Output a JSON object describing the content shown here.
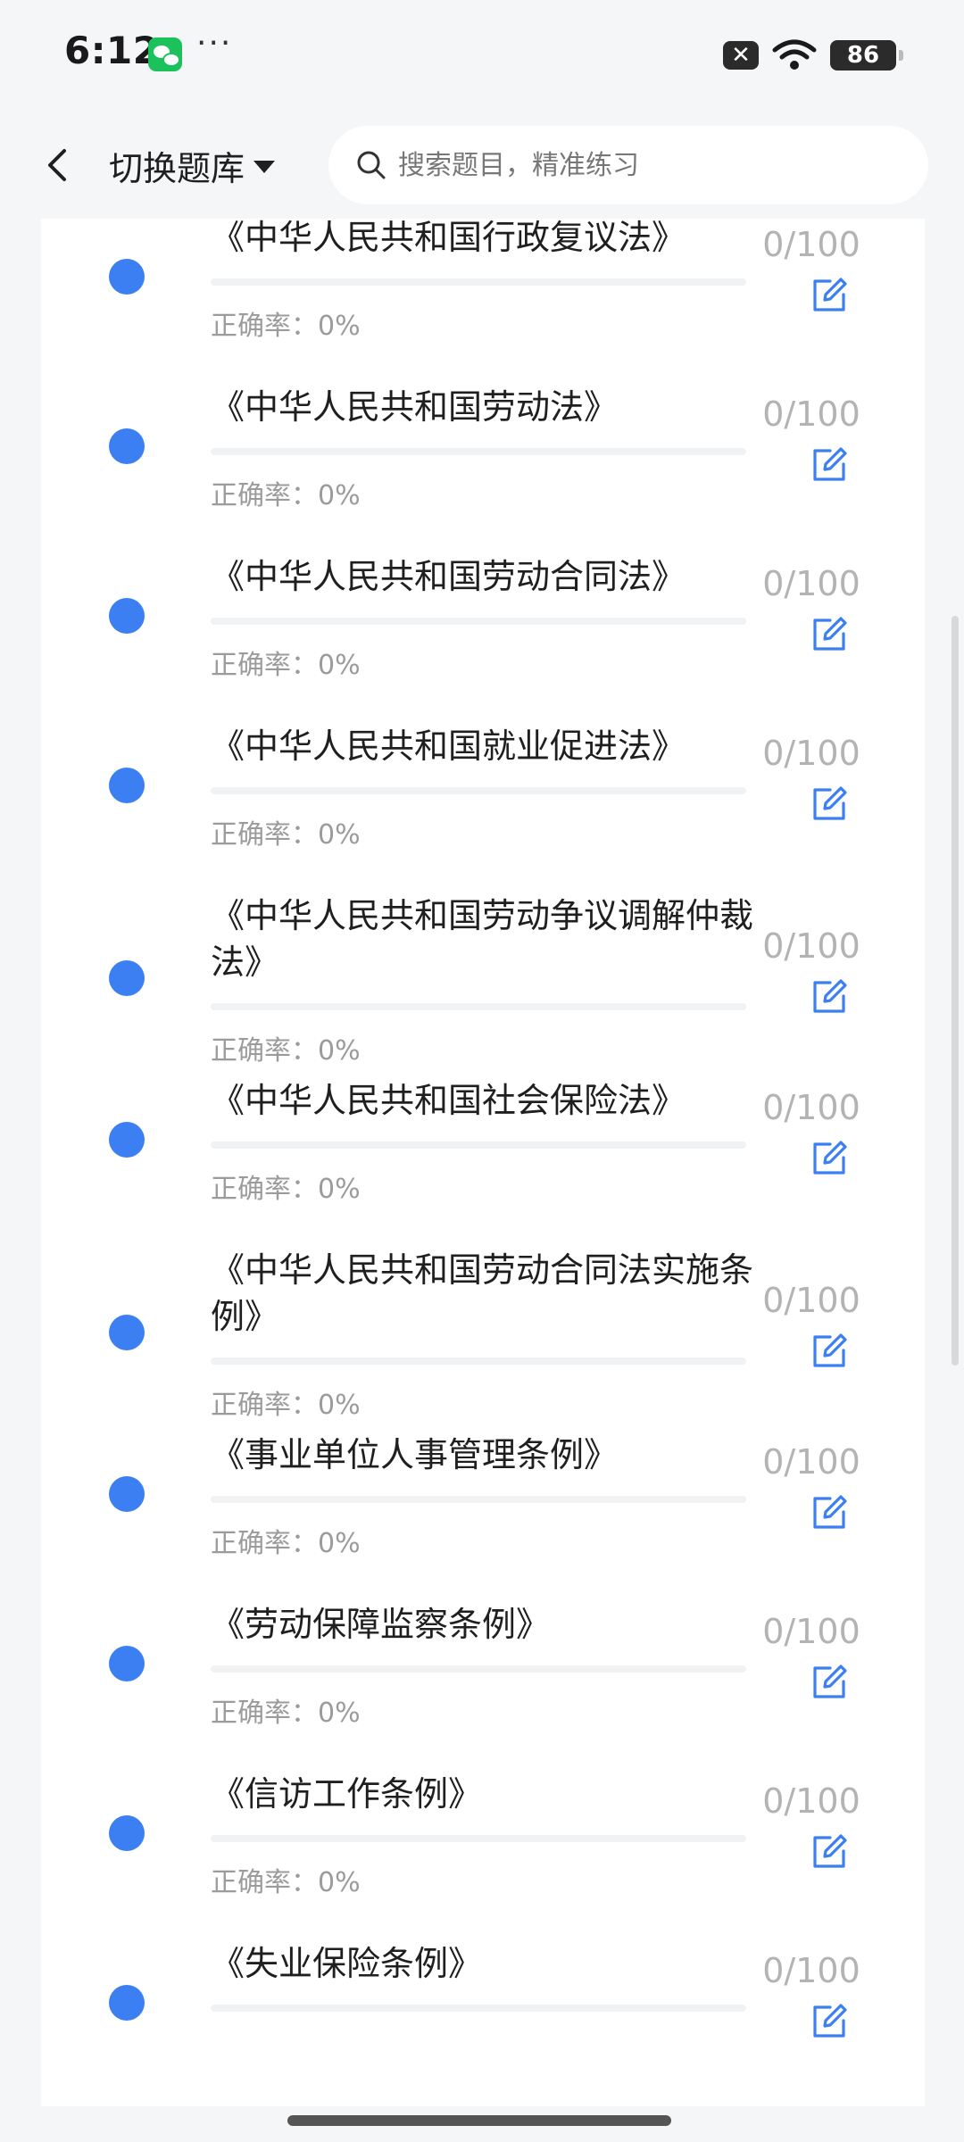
{
  "status_bar": {
    "time": "6:12",
    "more": "···",
    "x_badge": "✕",
    "battery": "86"
  },
  "header": {
    "back_icon": "chevron-left-icon",
    "switch_label": "切换题库",
    "search_placeholder": "搜索题目，精准练习"
  },
  "list": {
    "accuracy_label": "正确率：",
    "items": [
      {
        "title": "",
        "accuracy": "0%",
        "done": 0,
        "total": 100,
        "count_label": ""
      },
      {
        "title": "《中华人民共和国行政复议法》",
        "accuracy": "0%",
        "done": 0,
        "total": 100,
        "count_label": "0/100"
      },
      {
        "title": "《中华人民共和国劳动法》",
        "accuracy": "0%",
        "done": 0,
        "total": 100,
        "count_label": "0/100"
      },
      {
        "title": "《中华人民共和国劳动合同法》",
        "accuracy": "0%",
        "done": 0,
        "total": 100,
        "count_label": "0/100"
      },
      {
        "title": "《中华人民共和国就业促进法》",
        "accuracy": "0%",
        "done": 0,
        "total": 100,
        "count_label": "0/100"
      },
      {
        "title": "《中华人民共和国劳动争议调解仲裁法》",
        "accuracy": "0%",
        "done": 0,
        "total": 100,
        "count_label": "0/100"
      },
      {
        "title": "《中华人民共和国社会保险法》",
        "accuracy": "0%",
        "done": 0,
        "total": 100,
        "count_label": "0/100"
      },
      {
        "title": "《中华人民共和国劳动合同法实施条例》",
        "accuracy": "0%",
        "done": 0,
        "total": 100,
        "count_label": "0/100"
      },
      {
        "title": "《事业单位人事管理条例》",
        "accuracy": "0%",
        "done": 0,
        "total": 100,
        "count_label": "0/100"
      },
      {
        "title": "《劳动保障监察条例》",
        "accuracy": "0%",
        "done": 0,
        "total": 100,
        "count_label": "0/100"
      },
      {
        "title": "《信访工作条例》",
        "accuracy": "0%",
        "done": 0,
        "total": 100,
        "count_label": "0/100"
      },
      {
        "title": "《失业保险条例》",
        "accuracy": "",
        "done": 0,
        "total": 100,
        "count_label": "0/100"
      }
    ]
  },
  "colors": {
    "accent": "#3b7ff2",
    "muted_text": "#9b9b9b",
    "count_text": "#b3b3b3",
    "background": "#f5f6f8"
  },
  "icons": {
    "edit": "edit-icon",
    "search": "search-icon",
    "wifi": "wifi-icon",
    "wechat": "wechat-icon"
  }
}
